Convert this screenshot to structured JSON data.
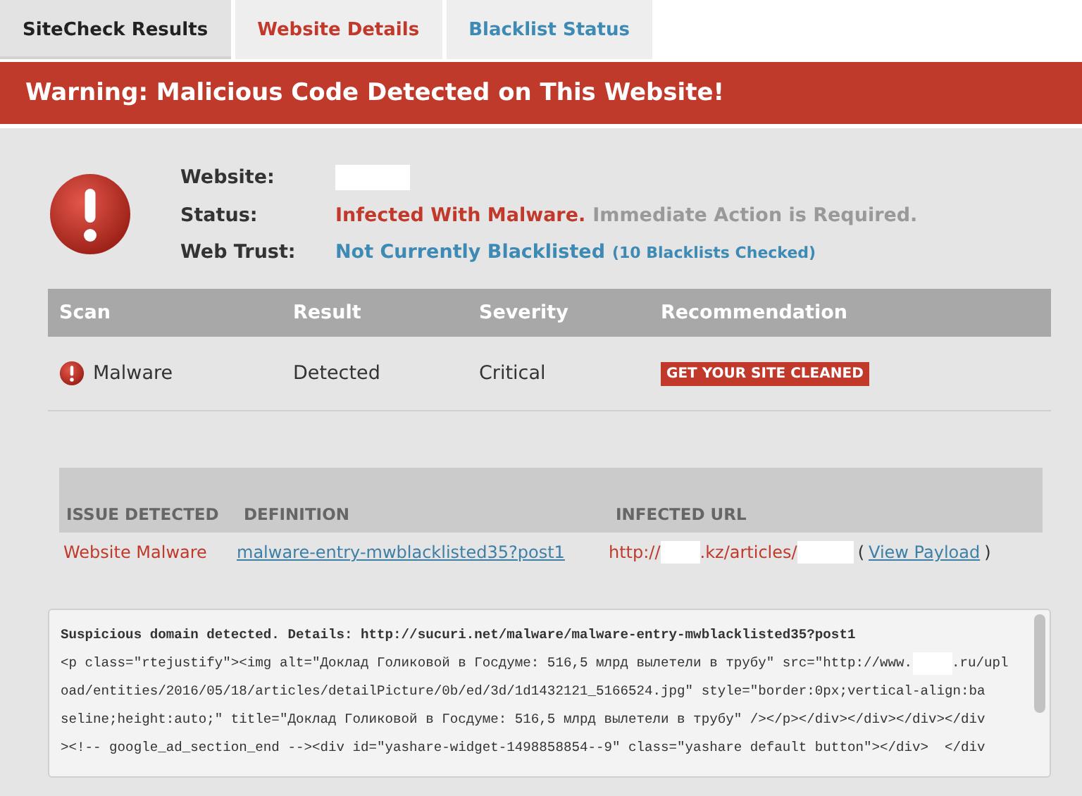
{
  "tabs": [
    {
      "label": "SiteCheck Results",
      "selected": true,
      "kind": "dark"
    },
    {
      "label": "Website Details",
      "selected": false,
      "kind": "red"
    },
    {
      "label": "Blacklist Status",
      "selected": false,
      "kind": "blue"
    }
  ],
  "banner": {
    "title": "Warning: Malicious Code Detected on This Website!"
  },
  "summary": {
    "website_label": "Website:",
    "status_label": "Status:",
    "status_value": "Infected With Malware.",
    "status_note": "Immediate Action is Required.",
    "trust_label": "Web Trust:",
    "trust_value": "Not Currently Blacklisted",
    "trust_note": "(10 Blacklists Checked)"
  },
  "scan_table": {
    "columns": [
      "Scan",
      "Result",
      "Severity",
      "Recommendation"
    ],
    "rows": [
      {
        "scan": "Malware",
        "result": "Detected",
        "severity": "Critical",
        "action": "GET YOUR SITE CLEANED"
      }
    ]
  },
  "issues_table": {
    "columns": [
      "ISSUE DETECTED",
      "DEFINITION",
      "INFECTED URL"
    ],
    "rows": [
      {
        "issue": "Website Malware",
        "definition": "malware-entry-mwblacklisted35?post1",
        "url_start": "http://",
        "url_middle": ".kz/articles/",
        "open_paren": "(",
        "payload_link": "View Payload",
        "close_paren": ")"
      }
    ]
  },
  "code_box": {
    "heading": "Suspicious domain detected. Details: http://sucuri.net/malware/malware-entry-mwblacklisted35?post1",
    "lines": [
      [
        "<p class=\"rtejustify\"><img alt=\"Доклад Голиковой в Госдуме: 516,5 млрд вылетели в трубу\" src=\"http://www.",
        ".ru/upl"
      ],
      [
        "oad/entities/2016/05/18/articles/detailPicture/0b/ed/3d/1d1432121_5166524.jpg\" style=\"border:0px;vertical-align:ba"
      ],
      [
        "seline;height:auto;\" title=\"Доклад Голиковой в Госдуме: 516,5 млрд вылетели в трубу\" /></p></div></div></div></div"
      ],
      [
        "><!-- google_ad_section_end --><div id=\"yashare-widget-1498858854--9\" class=\"yashare default button\"></div>  </div"
      ]
    ]
  }
}
